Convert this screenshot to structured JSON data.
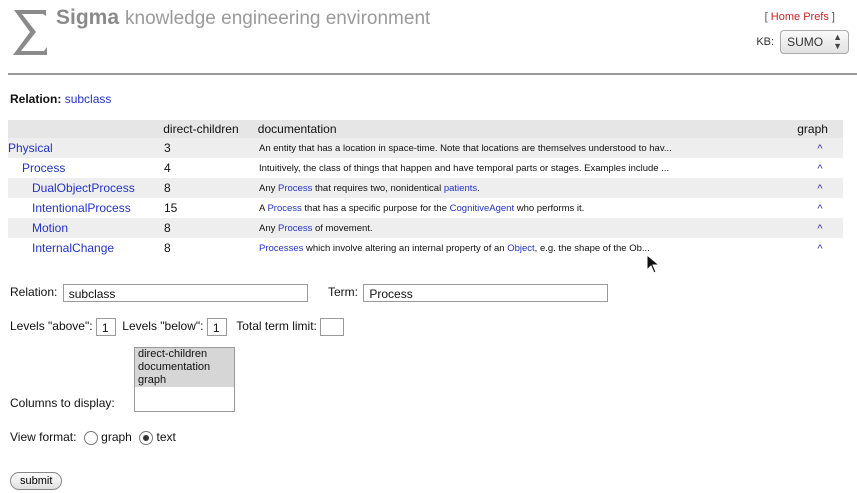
{
  "header": {
    "brand": "Sigma",
    "tagline": "knowledge engineering environment",
    "link_home": "Home",
    "link_prefs": "Prefs",
    "kb_label": "KB:",
    "kb_value": "SUMO"
  },
  "relation_header": {
    "label": "Relation:",
    "value": "subclass"
  },
  "table": {
    "columns": [
      "direct-children",
      "documentation",
      "graph"
    ],
    "rows": [
      {
        "term": "Physical",
        "indent": 0,
        "count": "3",
        "doc": "An entity that has a location in space-time. Note that locations are themselves understood to hav...",
        "graph": "^"
      },
      {
        "term": "Process",
        "indent": 1,
        "count": "4",
        "doc": "Intuitively, the class of things that happen and have temporal parts or stages. Examples include ...",
        "graph": "^"
      },
      {
        "term": "DualObjectProcess",
        "indent": 2,
        "count": "8",
        "doc_parts": [
          "Any ",
          "Process",
          " that requires two, nonidentical ",
          "patients",
          "."
        ],
        "graph": "^"
      },
      {
        "term": "IntentionalProcess",
        "indent": 2,
        "count": "15",
        "doc_parts": [
          "A ",
          "Process",
          " that has a specific purpose for the ",
          "CognitiveAgent",
          " who performs it."
        ],
        "graph": "^"
      },
      {
        "term": "Motion",
        "indent": 2,
        "count": "8",
        "doc_parts": [
          "Any ",
          "Process",
          " of movement."
        ],
        "graph": "^"
      },
      {
        "term": "InternalChange",
        "indent": 2,
        "count": "8",
        "doc_parts": [
          "Processes",
          " which involve altering an internal property of an ",
          "Object",
          ", e.g. the shape of the Ob..."
        ],
        "graph": "^"
      }
    ]
  },
  "form": {
    "relation_label": "Relation:",
    "relation_value": "subclass",
    "term_label": "Term:",
    "term_value": "Process",
    "levels_above_label": "Levels \"above\":",
    "levels_above_value": "1",
    "levels_below_label": "Levels \"below\":",
    "levels_below_value": "1",
    "total_limit_label": "Total term limit:",
    "total_limit_value": "",
    "columns_label": "Columns to display:",
    "columns_options": [
      "direct-children",
      "documentation",
      "graph"
    ],
    "view_format_label": "View format:",
    "view_options": [
      "graph",
      "text"
    ],
    "view_selected": "text",
    "submit_label": "submit"
  }
}
